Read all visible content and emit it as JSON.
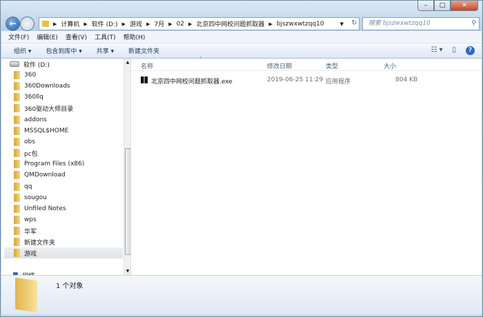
{
  "window": {
    "minimize": "–",
    "maximize": "□",
    "close": "✕"
  },
  "address": {
    "crumbs": [
      "计算机",
      "软件 (D:)",
      "游戏",
      "7月",
      "02",
      "北京四中网校问题抓取器",
      "bjszwxwtzqq10"
    ],
    "search_placeholder": "搜索 bjszwxwtzqq10"
  },
  "menu": [
    "文件(F)",
    "编辑(E)",
    "查看(V)",
    "工具(T)",
    "帮助(H)"
  ],
  "toolbar": [
    "组织 ▾",
    "包含到库中 ▾",
    "共享 ▾",
    "新建文件夹"
  ],
  "nav": {
    "drive": "软件 (D:)",
    "folders": [
      "360",
      "360Downloads",
      "360llq",
      "360驱动大师目录",
      "addons",
      "MSSQL$HOME",
      "obs",
      "pc包",
      "Program Files (x86)",
      "QMDownload",
      "qq",
      "sougou",
      "Unfiled Notes",
      "wps",
      "华军",
      "新建文件夹",
      "游戏"
    ],
    "selected": "游戏",
    "network": "网络"
  },
  "columns": {
    "name": "名称",
    "date": "修改日期",
    "type": "类型",
    "size": "大小"
  },
  "files": [
    {
      "name": "北京四中网校问题抓取器.exe",
      "date": "2019-06-25 11:29",
      "type": "应用程序",
      "size": "804 KB"
    }
  ],
  "details": {
    "count": "1 个对象"
  }
}
